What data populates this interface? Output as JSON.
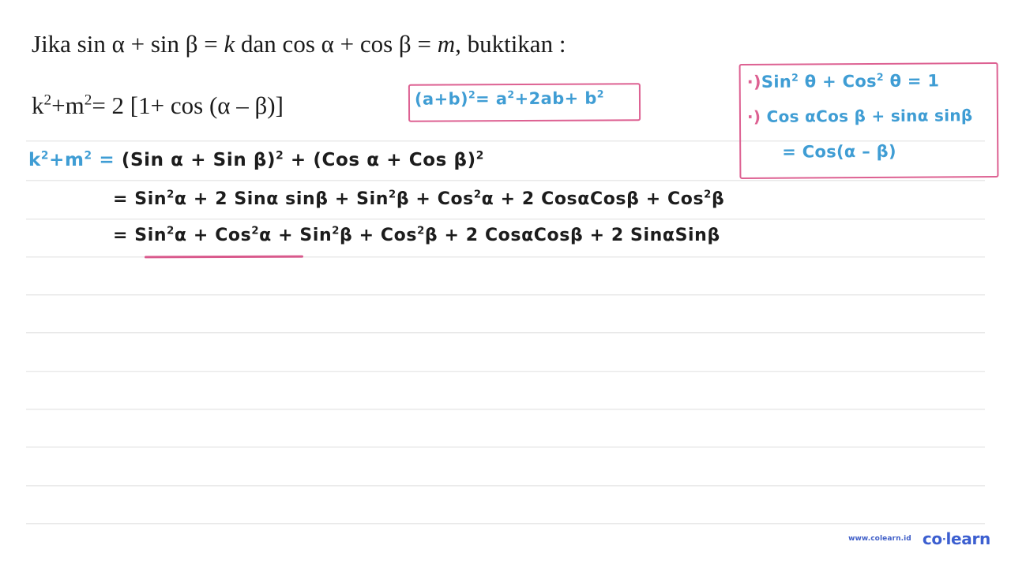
{
  "page": {
    "background_color": "#ffffff",
    "rule_color": "#e9e9e9",
    "rule_y_positions": [
      178,
      228,
      277,
      325,
      373,
      421,
      470,
      518,
      566,
      615,
      663
    ],
    "ink_color": "#1c1c1c",
    "blue_ink_color": "#3f9dd4",
    "pink_ink_color": "#dd6192"
  },
  "question": {
    "line1": {
      "before_k": "Jika sin α + sin β = ",
      "k": "k",
      "middle": " dan cos α + cos β = ",
      "m": "m",
      "after": ", buktikan :"
    },
    "line2": {
      "k": "k",
      "k_exp": "2",
      "plus": "+m",
      "m_exp": "2",
      "rest": "= 2 [1+ cos (α – β)]"
    }
  },
  "identity_box": {
    "lhs_open": "(a+b)",
    "lhs_exp": "2",
    "eq": "= a",
    "a_exp": "2",
    "mid": "+2ab+ b",
    "b_exp": "2"
  },
  "notes_box": {
    "rows": [
      {
        "bullet": "·)",
        "text_a": "Sin",
        "exp_a": "2",
        "text_b": " θ + Cos",
        "exp_b": "2",
        "text_c": " θ = 1"
      },
      {
        "bullet": "·)",
        "text": " Cos αCos β + sinα sinβ"
      },
      {
        "text": "= Cos(α – β)"
      }
    ]
  },
  "work": {
    "line1": {
      "lead_k": "k",
      "lead_k_exp": "2",
      "lead_plus": "+m",
      "lead_m_exp": "2",
      "lead_eq": " =",
      "rest_a": " (Sin α + Sin β)",
      "rest_a_exp": "2",
      "rest_b": " + (Cos α + Cos β)",
      "rest_b_exp": "2"
    },
    "line2": {
      "eq": "= Sin",
      "e1": "2",
      "t1": "α + 2 Sinα sinβ + Sin",
      "e2": "2",
      "t2": "β + Cos",
      "e3": "2",
      "t3": "α + 2 CosαCosβ + Cos",
      "e4": "2",
      "t4": "β"
    },
    "line3": {
      "eq": "= Sin",
      "e1": "2",
      "t1": "α + Cos",
      "e2": "2",
      "t2": "α + Sin",
      "e3": "2",
      "t3": "β + Cos",
      "e4": "2",
      "t4": "β + 2 CosαCosβ + 2 SinαSinβ"
    },
    "underline_note": "pink underline under Sin²α + Cos²α"
  },
  "watermark": {
    "url": "www.colearn.id",
    "brand_a": "co",
    "brand_dot": "·",
    "brand_b": "learn"
  }
}
